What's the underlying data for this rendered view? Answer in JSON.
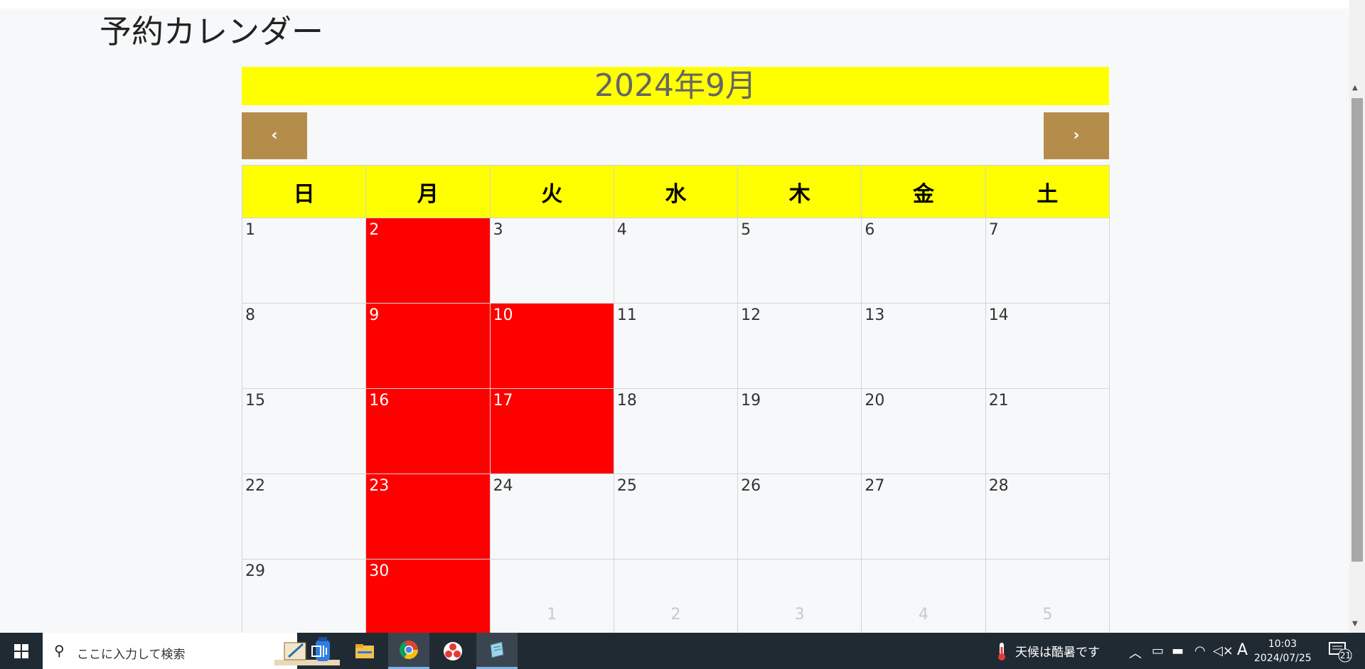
{
  "page": {
    "title": "予約カレンダー"
  },
  "calendar": {
    "month_label": "2024年9月",
    "prev_label": "‹",
    "next_label": "›",
    "weekdays": [
      "日",
      "月",
      "火",
      "水",
      "木",
      "金",
      "土"
    ],
    "weeks": [
      [
        {
          "label": "1",
          "booked": false
        },
        {
          "label": "2",
          "booked": true
        },
        {
          "label": "3",
          "booked": false
        },
        {
          "label": "4",
          "booked": false
        },
        {
          "label": "5",
          "booked": false
        },
        {
          "label": "6",
          "booked": false
        },
        {
          "label": "7",
          "booked": false
        }
      ],
      [
        {
          "label": "8",
          "booked": false
        },
        {
          "label": "9",
          "booked": true
        },
        {
          "label": "10",
          "booked": true
        },
        {
          "label": "11",
          "booked": false
        },
        {
          "label": "12",
          "booked": false
        },
        {
          "label": "13",
          "booked": false
        },
        {
          "label": "14",
          "booked": false
        }
      ],
      [
        {
          "label": "15",
          "booked": false
        },
        {
          "label": "16",
          "booked": true
        },
        {
          "label": "17",
          "booked": true
        },
        {
          "label": "18",
          "booked": false
        },
        {
          "label": "19",
          "booked": false
        },
        {
          "label": "20",
          "booked": false
        },
        {
          "label": "21",
          "booked": false
        }
      ],
      [
        {
          "label": "22",
          "booked": false
        },
        {
          "label": "23",
          "booked": true
        },
        {
          "label": "24",
          "booked": false
        },
        {
          "label": "25",
          "booked": false
        },
        {
          "label": "26",
          "booked": false
        },
        {
          "label": "27",
          "booked": false
        },
        {
          "label": "28",
          "booked": false
        }
      ],
      [
        {
          "label": "29",
          "booked": false
        },
        {
          "label": "30",
          "booked": true
        },
        {
          "label": "1",
          "booked": false,
          "other": true
        },
        {
          "label": "2",
          "booked": false,
          "other": true
        },
        {
          "label": "3",
          "booked": false,
          "other": true
        },
        {
          "label": "4",
          "booked": false,
          "other": true
        },
        {
          "label": "5",
          "booked": false,
          "other": true
        }
      ]
    ],
    "colors": {
      "header_bg": "#ffff00",
      "booked": "#ff0000",
      "nav_btn": "#b58d4b"
    }
  },
  "taskbar": {
    "search_placeholder": "ここに入力して検索",
    "weather_text": "天候は酷暑です",
    "ime_indicator": "A",
    "clock_time": "10:03",
    "clock_date": "2024/07/25",
    "notification_count": "21",
    "apps": [
      "task-view-icon",
      "file-explorer-icon",
      "chrome-icon",
      "app-icon",
      "notepad-icon"
    ]
  }
}
